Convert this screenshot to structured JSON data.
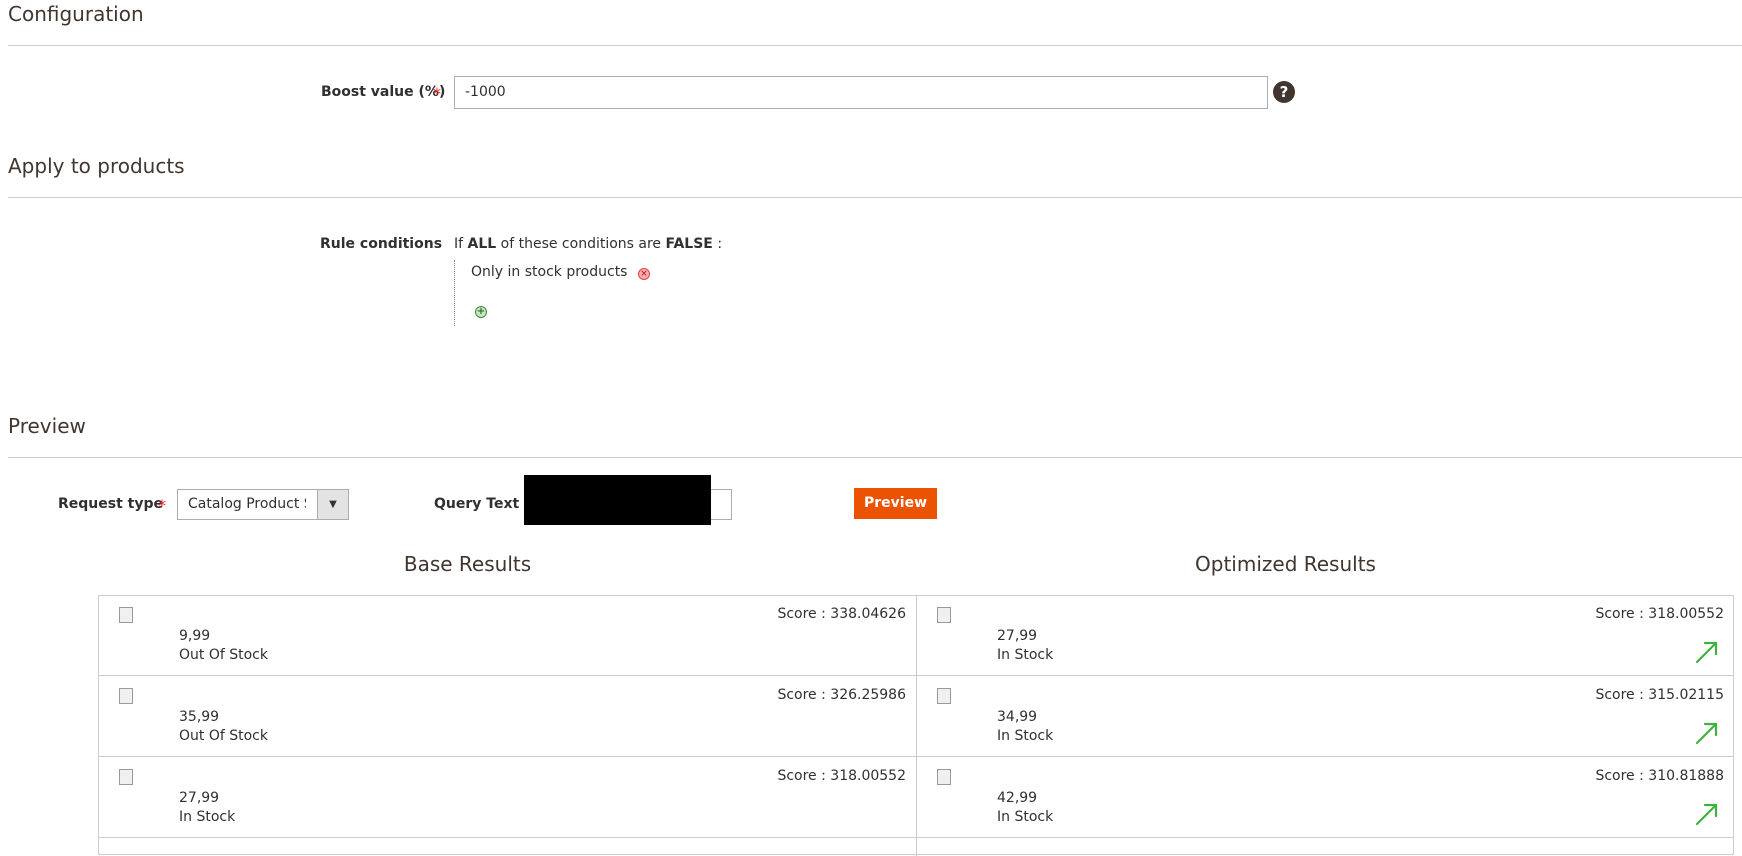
{
  "configuration": {
    "title": "Configuration",
    "boost_label": "Boost value (%)",
    "required_mark": "*",
    "boost_value": "-1000",
    "help_glyph": "?"
  },
  "apply": {
    "title": "Apply to products",
    "rule_label": "Rule conditions",
    "cond_if": "If",
    "cond_all": "ALL",
    "cond_middle": "of these conditions are",
    "cond_false": "FALSE",
    "cond_colon": ":",
    "condition_item": "Only in stock products",
    "delete_icon": "remove-condition-icon",
    "add_icon": "add-condition-icon"
  },
  "preview": {
    "title": "Preview",
    "request_type_label": "Request type",
    "required_mark": "*",
    "request_type_value": "Catalog Product S",
    "query_text_label": "Query Text",
    "preview_button": "Preview",
    "base_title": "Base Results",
    "optimized_title": "Optimized Results"
  },
  "base_results": [
    {
      "price": "9,99",
      "stock": "Out Of Stock",
      "score": "Score : 338.04626"
    },
    {
      "price": "35,99",
      "stock": "Out Of Stock",
      "score": "Score : 326.25986"
    },
    {
      "price": "27,99",
      "stock": "In Stock",
      "score": "Score : 318.00552"
    }
  ],
  "optimized_results": [
    {
      "price": "27,99",
      "stock": "In Stock",
      "score": "Score : 318.00552",
      "trend": "up-arrow-icon"
    },
    {
      "price": "34,99",
      "stock": "In Stock",
      "score": "Score : 315.02115",
      "trend": "up-arrow-icon"
    },
    {
      "price": "42,99",
      "stock": "In Stock",
      "score": "Score : 310.81888",
      "trend": "up-arrow-icon"
    }
  ],
  "colors": {
    "accent": "#eb5202",
    "trend_up": "#3fb13f",
    "required": "#e22626"
  }
}
